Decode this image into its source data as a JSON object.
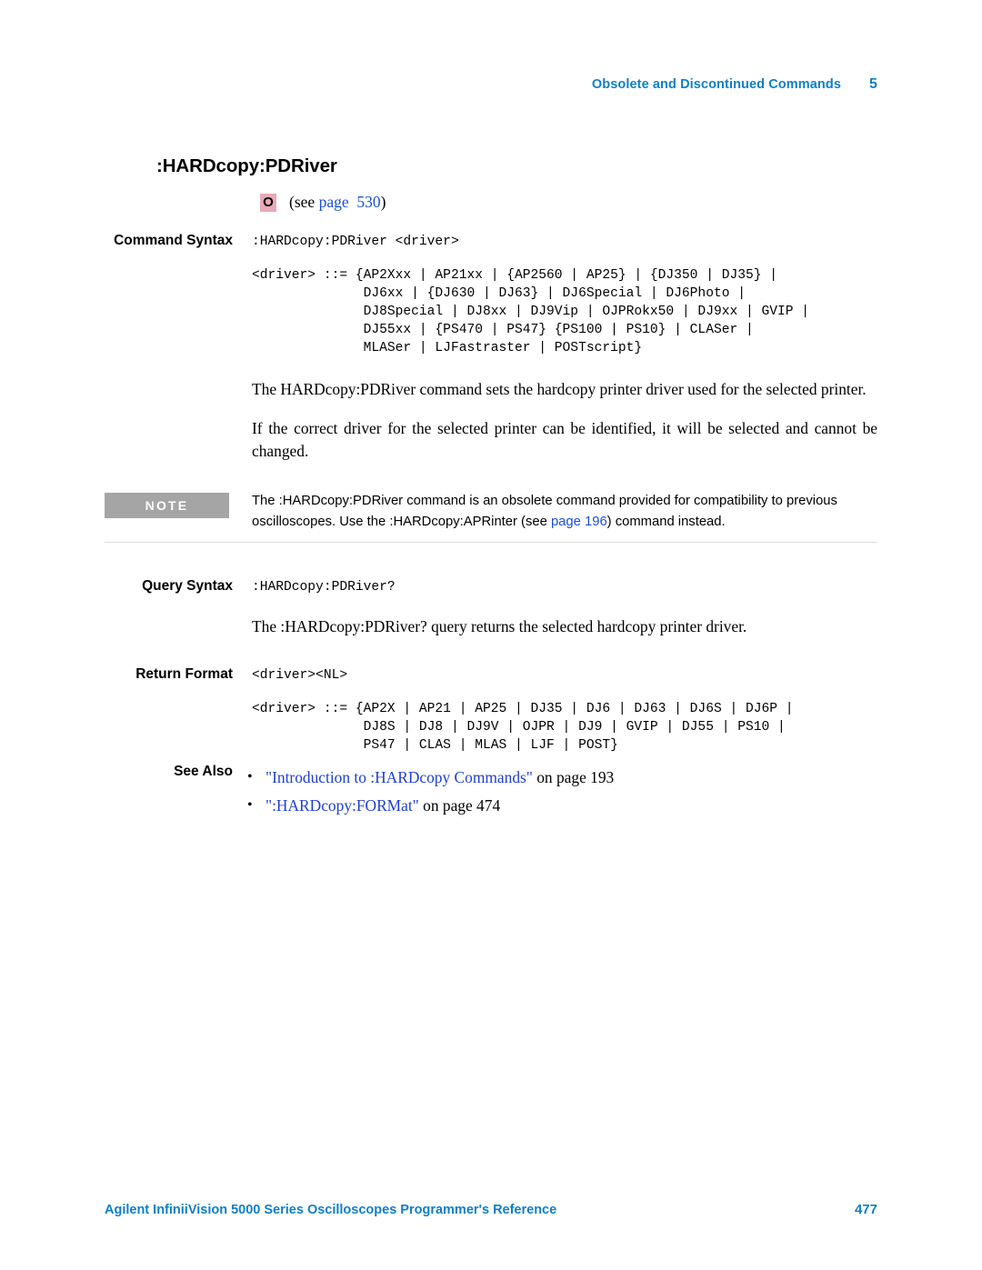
{
  "header": {
    "chapter_title": "Obsolete and Discontinued Commands",
    "chapter_number": "5"
  },
  "command": {
    "title": ":HARDcopy:PDRiver",
    "obsolete_badge": "O",
    "see_prefix": "(see ",
    "see_link": "page  530",
    "see_suffix": ")"
  },
  "command_syntax": {
    "label": "Command Syntax",
    "syntax": ":HARDcopy:PDRiver <driver>",
    "driver_lines": [
      "<driver> ::= {AP2Xxx | AP21xx | {AP2560 | AP25} | {DJ350 | DJ35} |",
      "              DJ6xx | {DJ630 | DJ63} | DJ6Special | DJ6Photo |",
      "              DJ8Special | DJ8xx | DJ9Vip | OJPRokx50 | DJ9xx | GVIP |",
      "              DJ55xx | {PS470 | PS47} {PS100 | PS10} | CLASer |",
      "              MLASer | LJFastraster | POSTscript}"
    ],
    "paragraphs": [
      "The HARDcopy:PDRiver command sets the hardcopy printer driver used for the selected printer.",
      "If the correct driver for the selected printer can be identified, it will be selected and cannot be changed."
    ]
  },
  "note": {
    "label": "NOTE",
    "text_before_link": "The :HARDcopy:PDRiver command is an obsolete command provided for compatibility to previous oscilloscopes. Use the :HARDcopy:APRinter (see ",
    "link": "page 196",
    "text_after_link": ") command instead."
  },
  "query_syntax": {
    "label": "Query Syntax",
    "syntax": ":HARDcopy:PDRiver?",
    "paragraph": "The :HARDcopy:PDRiver? query returns the selected hardcopy printer driver."
  },
  "return_format": {
    "label": "Return Format",
    "format": "<driver><NL>",
    "driver_lines": [
      "<driver> ::= {AP2X | AP21 | AP25 | DJ35 | DJ6 | DJ63 | DJ6S | DJ6P |",
      "              DJ8S | DJ8 | DJ9V | OJPR | DJ9 | GVIP | DJ55 | PS10 |",
      "              PS47 | CLAS | MLAS | LJF | POST}"
    ]
  },
  "see_also": {
    "label": "See Also",
    "items": [
      {
        "link": "\"Introduction to :HARDcopy Commands\"",
        "tail": " on  page  193"
      },
      {
        "link": "\":HARDcopy:FORMat\"",
        "tail": " on  page  474"
      }
    ]
  },
  "footer": {
    "text": "Agilent InfiniiVision 5000 Series Oscilloscopes Programmer's Reference",
    "page_number": "477"
  },
  "colors": {
    "accent_blue": "#0f7fc6",
    "link_blue": "#2040d0",
    "note_gray": "#a5a5a5",
    "badge_pink": "#e8a9b8",
    "rule_gray": "#dcdcdc"
  }
}
